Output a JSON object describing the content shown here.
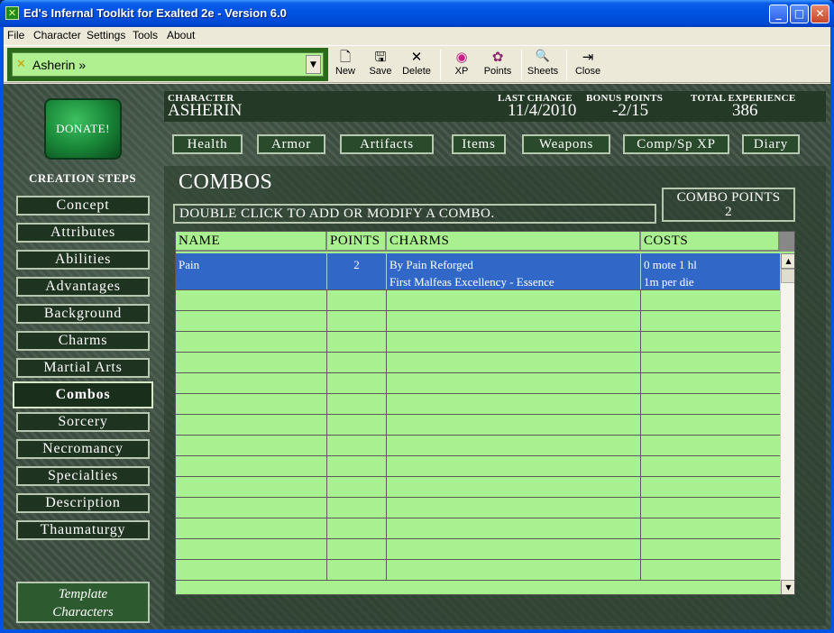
{
  "window": {
    "title": "Ed's Infernal Toolkit for Exalted 2e - Version 6.0",
    "icon": "toolkit-x-icon"
  },
  "menu": [
    "File",
    "Character",
    "Settings",
    "Tools",
    "About"
  ],
  "toolbar": {
    "character_combo": "Asherin »",
    "buttons": [
      {
        "label": "New",
        "icon": "new-document-icon",
        "glyph": "🗋"
      },
      {
        "label": "Save",
        "icon": "floppy-disk-icon",
        "glyph": "🖫"
      },
      {
        "label": "Delete",
        "icon": "delete-x-icon",
        "glyph": "✕"
      },
      {
        "label": "XP",
        "icon": "xp-swirl-icon",
        "glyph": "◉"
      },
      {
        "label": "Points",
        "icon": "points-icon",
        "glyph": "✿"
      },
      {
        "label": "Sheets",
        "icon": "sheets-magnifier-icon",
        "glyph": "🔍"
      },
      {
        "label": "Close",
        "icon": "exit-door-icon",
        "glyph": "⇥"
      }
    ]
  },
  "sidebar": {
    "donate": "DONATE!",
    "creation_title": "CREATION STEPS",
    "steps": [
      "Concept",
      "Attributes",
      "Abilities",
      "Advantages",
      "Background",
      "Charms",
      "Martial Arts",
      "Combos",
      "Sorcery",
      "Necromancy",
      "Specialties",
      "Description",
      "Thaumaturgy"
    ],
    "active_step": "Combos",
    "template_line1": "Template",
    "template_line2": "Characters"
  },
  "header": {
    "character_label": "CHARACTER",
    "character_name": "ASHERIN",
    "last_change_label": "LAST CHANGE",
    "last_change": "11/4/2010",
    "bonus_points_label": "BONUS POINTS",
    "bonus_points": "-2/15",
    "total_xp_label": "TOTAL EXPERIENCE",
    "total_xp": "386"
  },
  "tabs": [
    "Health",
    "Armor",
    "Artifacts",
    "Items",
    "Weapons",
    "Comp/Sp XP",
    "Diary"
  ],
  "panel": {
    "title": "COMBOS",
    "instruction": "DOUBLE CLICK TO ADD OR MODIFY A COMBO.",
    "combo_points_label": "COMBO POINTS",
    "combo_points": "2"
  },
  "grid": {
    "columns": [
      "NAME",
      "POINTS",
      "CHARMS",
      "COSTS"
    ],
    "rows": [
      {
        "name": "Pain",
        "points": "2",
        "charms_line1": "By Pain Reforged",
        "charms_line2": "First Malfeas Excellency - Essence",
        "costs_line1": "0 mote  1 hl",
        "costs_line2": "1m per die"
      }
    ],
    "empty_rows": 14
  }
}
